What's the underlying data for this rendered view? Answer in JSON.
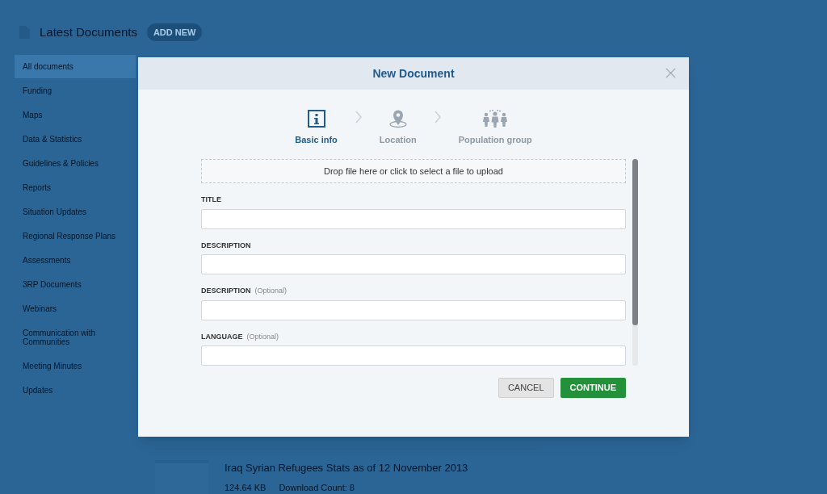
{
  "page": {
    "heading": "Latest Documents",
    "add_button": "ADD NEW",
    "sidebar": [
      {
        "label": "All documents",
        "selected": true
      },
      {
        "label": "Funding",
        "selected": false
      },
      {
        "label": "Maps",
        "selected": false
      },
      {
        "label": "Data & Statistics",
        "selected": false
      },
      {
        "label": "Guidelines & Policies",
        "selected": false
      },
      {
        "label": "Reports",
        "selected": false
      },
      {
        "label": "Situation Updates",
        "selected": false
      },
      {
        "label": "Regional Response Plans",
        "selected": false
      },
      {
        "label": "Assessments",
        "selected": false
      },
      {
        "label": "3RP Documents",
        "selected": false
      },
      {
        "label": "Webinars",
        "selected": false
      },
      {
        "label": "Communication with Communities",
        "selected": false
      },
      {
        "label": "Meeting Minutes",
        "selected": false
      },
      {
        "label": "Updates",
        "selected": false
      }
    ],
    "document": {
      "title": "Iraq Syrian Refugees Stats as of 12 November 2013",
      "size": "124.64 KB",
      "downloads": "Download Count: 8"
    }
  },
  "dialog": {
    "title": "New Document",
    "steps": [
      {
        "kind": "info",
        "label": "Basic info",
        "selected": true
      },
      {
        "kind": "location",
        "label": "Location",
        "selected": false
      },
      {
        "kind": "population",
        "label": "Population group",
        "selected": false
      }
    ],
    "dropzone": "Drop file here or click to select a file to upload",
    "fields": [
      {
        "label": "TITLE"
      },
      {
        "label": "DESCRIPTION"
      },
      {
        "label": "DESCRIPTION",
        "note": "(Optional)"
      },
      {
        "label": "LANGUAGE",
        "note": "(Optional)"
      }
    ],
    "buttons": [
      {
        "kind": "secondary",
        "label": "CANCEL"
      },
      {
        "kind": "primary",
        "label": "CONTINUE"
      }
    ]
  }
}
